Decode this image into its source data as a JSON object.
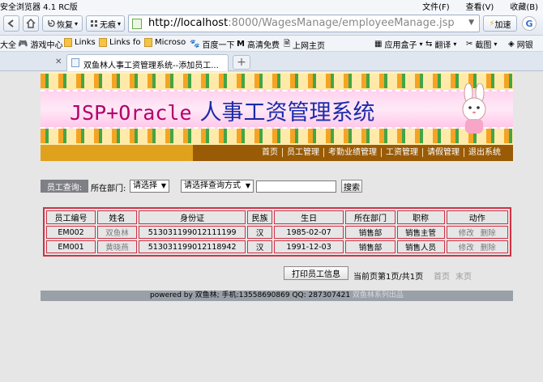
{
  "browser": {
    "title": "安全浏览器 4.1 RC版",
    "menu": [
      "文件(F)",
      "查看(V)",
      "收藏(B)"
    ],
    "nav": {
      "refresh_label": "恢复",
      "trace_label": "无痕",
      "url_host": "http://localhost",
      "url_path": ":8000/WagesManage/employeeManage.jsp",
      "speed_label": "加速"
    },
    "favorites": [
      {
        "label": "大全"
      },
      {
        "label": "游戏中心"
      },
      {
        "label": "Links"
      },
      {
        "label": "Links fo"
      },
      {
        "label": "Microso"
      },
      {
        "label": "百度一下"
      },
      {
        "label": "高清免费"
      },
      {
        "label": "上网主页"
      },
      {
        "label": "应用盒子"
      },
      {
        "label": "翻译"
      },
      {
        "label": "截图"
      },
      {
        "label": "网银"
      }
    ],
    "tab": {
      "title": "双鱼林人事工资管理系统--添加员工..."
    }
  },
  "banner": {
    "title_en": "JSP+Oracle",
    "title_cn": "人事工资管理系统"
  },
  "nav_links": [
    "首页",
    "员工管理",
    "考勤业绩管理",
    "工资管理",
    "请假管理",
    "退出系统"
  ],
  "query": {
    "label": "员工查询:",
    "dept_label": "所在部门:",
    "dept_select": "请选择",
    "method_select": "请选择查询方式",
    "search_button": "搜索"
  },
  "table": {
    "headers": [
      "员工编号",
      "姓名",
      "身份证",
      "民族",
      "生日",
      "所在部门",
      "职称",
      "动作"
    ],
    "rows": [
      {
        "id": "EM002",
        "name": "双鱼林",
        "idcard": "513031199012111199",
        "nation": "汉",
        "birthday": "1985-02-07",
        "dept": "销售部",
        "title": "销售主管",
        "edit": "修改",
        "delete": "删除"
      },
      {
        "id": "EM001",
        "name": "黄晓燕",
        "idcard": "513031199012118942",
        "nation": "汉",
        "birthday": "1991-12-03",
        "dept": "销售部",
        "title": "销售人员",
        "edit": "修改",
        "delete": "删除"
      }
    ]
  },
  "footer": {
    "print_button": "打印员工信息",
    "page_info": "当前页第1页/共1页",
    "first_page": "首页",
    "last_page": "末页",
    "powered_by": "powered by 双鱼林; 手机:13558690869 QQ: 287307421",
    "series": "双鱼林系列出品"
  },
  "colors": {
    "table_border": "#cf3245",
    "nav_strip": "#9a5b06",
    "nav_accent": "#e0a21d",
    "query_label_bg": "#7f7f86"
  }
}
